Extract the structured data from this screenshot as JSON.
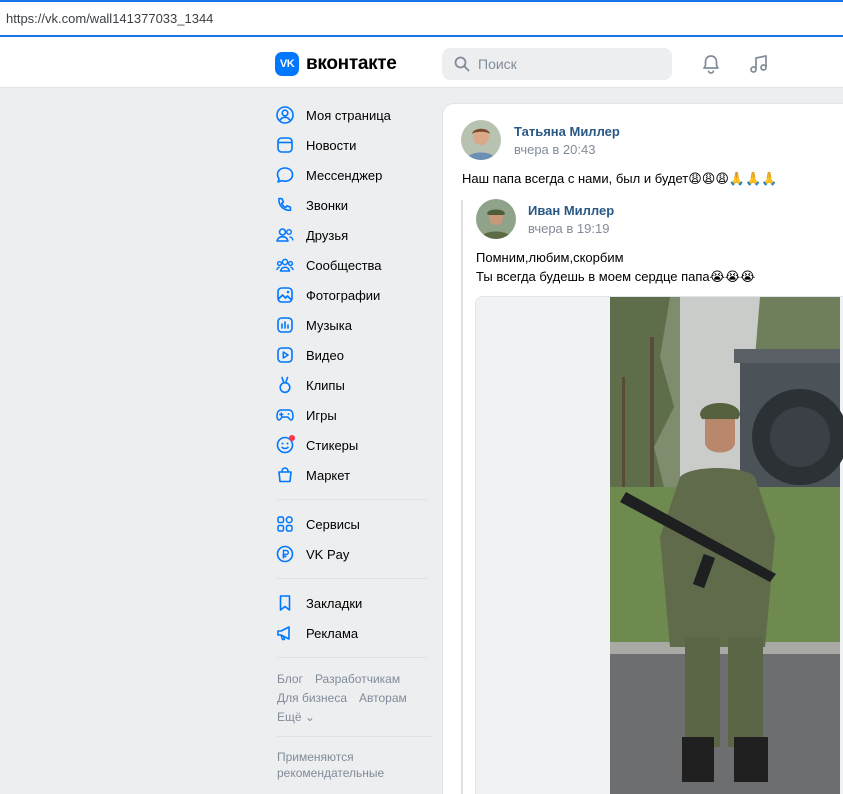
{
  "browser": {
    "url": "https://vk.com/wall141377033_1344"
  },
  "header": {
    "logo_mark": "VK",
    "logo_text": "вконтакте",
    "search_placeholder": "Поиск",
    "icons": [
      "search-icon",
      "bell-icon",
      "music-icon"
    ]
  },
  "sidebar": {
    "group1": [
      {
        "label": "Моя страница",
        "icon": "user-circle-icon"
      },
      {
        "label": "Новости",
        "icon": "news-icon"
      },
      {
        "label": "Мессенджер",
        "icon": "message-icon"
      },
      {
        "label": "Звонки",
        "icon": "phone-icon"
      },
      {
        "label": "Друзья",
        "icon": "friends-icon"
      },
      {
        "label": "Сообщества",
        "icon": "communities-icon"
      },
      {
        "label": "Фотографии",
        "icon": "photo-icon"
      },
      {
        "label": "Музыка",
        "icon": "music-icon"
      },
      {
        "label": "Видео",
        "icon": "video-icon"
      },
      {
        "label": "Клипы",
        "icon": "clips-icon"
      },
      {
        "label": "Игры",
        "icon": "gamepad-icon"
      },
      {
        "label": "Стикеры",
        "icon": "sticker-icon"
      },
      {
        "label": "Маркет",
        "icon": "bag-icon"
      }
    ],
    "group2": [
      {
        "label": "Сервисы",
        "icon": "services-icon"
      },
      {
        "label": "VK Pay",
        "icon": "ruble-icon"
      }
    ],
    "group3": [
      {
        "label": "Закладки",
        "icon": "bookmark-icon"
      },
      {
        "label": "Реклама",
        "icon": "megaphone-icon"
      }
    ],
    "footer": {
      "row1": [
        "Блог",
        "Разработчикам"
      ],
      "row2": [
        "Для бизнеса",
        "Авторам"
      ],
      "more": "Ещё ⌄",
      "note_line1": "Применяются",
      "note_line2": "рекомендательные"
    }
  },
  "post": {
    "author": "Татьяна Миллер",
    "time": "вчера в 20:43",
    "text": "Наш папа всегда с нами, был и будет😩😩😩🙏🙏🙏",
    "repost": {
      "author": "Иван Миллер",
      "time": "вчера в 19:19",
      "text_line1": "Помним,любим,скорбим",
      "text_line2": "Ты всегда будешь в моем сердце папа😭😭😭"
    }
  },
  "colors": {
    "accent": "#0077ff",
    "link": "#2a5885",
    "muted": "#818c99",
    "bg": "#edeef0"
  }
}
